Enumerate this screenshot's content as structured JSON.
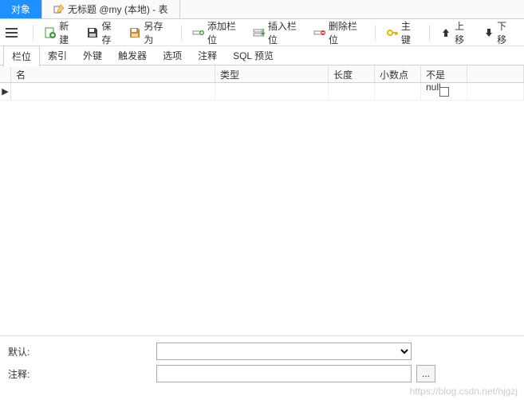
{
  "tabs": {
    "object": "对象",
    "untitled": "无标题 @my (本地) - 表"
  },
  "toolbar": {
    "new": "新建",
    "save": "保存",
    "saveas": "另存为",
    "addfield": "添加栏位",
    "insertfield": "插入栏位",
    "deletefield": "删除栏位",
    "primarykey": "主键",
    "moveup": "上移",
    "movedown": "下移"
  },
  "subtabs": {
    "fields": "栏位",
    "indexes": "索引",
    "foreignkeys": "外键",
    "triggers": "触发器",
    "options": "选项",
    "comment": "注释",
    "sqlpreview": "SQL 预览"
  },
  "columns": {
    "name": "名",
    "type": "类型",
    "length": "长度",
    "decimals": "小数点",
    "notnull": "不是 null"
  },
  "row": {
    "name": "",
    "type": "",
    "length": "",
    "decimals": "",
    "notnull": false
  },
  "bottom": {
    "default_label": "默认:",
    "default_value": "",
    "comment_label": "注释:",
    "comment_value": "",
    "ell": "..."
  },
  "watermark": "https://blog.csdn.net/hjgzj"
}
